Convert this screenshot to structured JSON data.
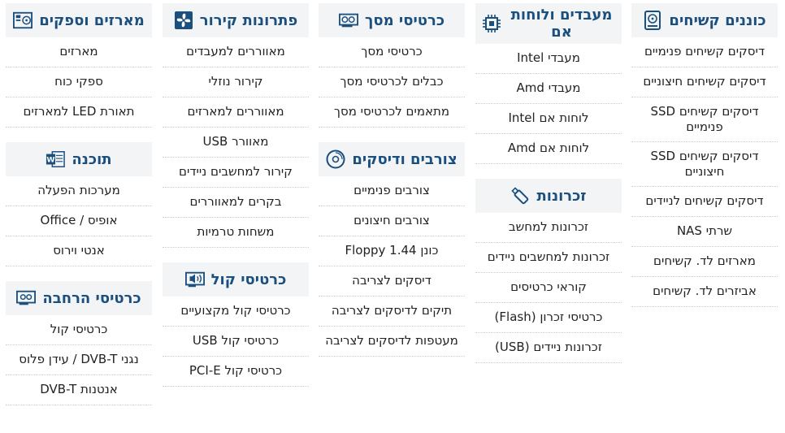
{
  "columns": [
    {
      "groups": [
        {
          "title": "כוננים קשיחים",
          "icon": "hard-drive-icon",
          "items": [
            "דיסקים קשיחים פנימיים",
            "דיסקים קשיחים חיצוניים",
            "דיסקים קשיחים SSD פנימיים",
            "דיסקים קשיחים SSD חיצוניים",
            "דיסקים קשיחים לניידים",
            "שרתי NAS",
            "מארזים לד. קשיחים",
            "אביזרים לד. קשיחים"
          ]
        }
      ]
    },
    {
      "groups": [
        {
          "title": "מעבדים ולוחות אם",
          "icon": "cpu-icon",
          "items": [
            "מעבדי Intel",
            "מעבדי Amd",
            "לוחות אם Intel",
            "לוחות אם Amd"
          ]
        },
        {
          "title": "זכרונות",
          "icon": "usb-stick-icon",
          "items": [
            "זכרונות למחשב",
            "זכרונות למחשבים ניידים",
            "קוראי כרטיסים",
            "כרטיסי זכרון (Flash)",
            "זכרונות ניידים (USB)"
          ]
        }
      ]
    },
    {
      "groups": [
        {
          "title": "כרטיסי מסך",
          "icon": "graphics-card-icon",
          "items": [
            "כרטיסי מסך",
            "כבלים לכרטיסי מסך",
            "מתאמים לכרטיסי מסך"
          ]
        },
        {
          "title": "צורבים ודיסקים",
          "icon": "disc-icon",
          "items": [
            "צורבים פנימיים",
            "צורבים חיצונים",
            "Floppy 1.44 כונן",
            "דיסקים לצריבה",
            "תיקים לדיסקים לצריבה",
            "מעטפות לדיסקים לצריבה"
          ]
        }
      ]
    },
    {
      "groups": [
        {
          "title": "פתרונות קירור",
          "icon": "fan-icon",
          "items": [
            "מאווררים למעבדים",
            "קירור נוזלי",
            "מאווררים למארזים",
            "מאוורר USB",
            "קירור למחשבים ניידים",
            "בקרים למאווררים",
            "משחות טרמיות"
          ]
        },
        {
          "title": "כרטיסי קול",
          "icon": "sound-card-icon",
          "items": [
            "כרטיסי קול מקצועיים",
            "כרטיסי קול USB",
            "כרטיסי קול PCI-E"
          ]
        }
      ]
    },
    {
      "groups": [
        {
          "title": "מארזים וספקים",
          "icon": "computer-case-icon",
          "items": [
            "מארזים",
            "ספקי כוח",
            "תאורת LED למארזים"
          ]
        },
        {
          "title": "תוכנה",
          "icon": "word-document-icon",
          "items": [
            "מערכות הפעלה",
            "אופיס / Office",
            "אנטי וירוס"
          ]
        },
        {
          "title": "כרטיסי הרחבה",
          "icon": "expansion-card-icon",
          "items": [
            "כרטיסי קול",
            "נגני DVB-T / עידן פלוס",
            "אנטנות DVB-T"
          ]
        }
      ]
    }
  ]
}
